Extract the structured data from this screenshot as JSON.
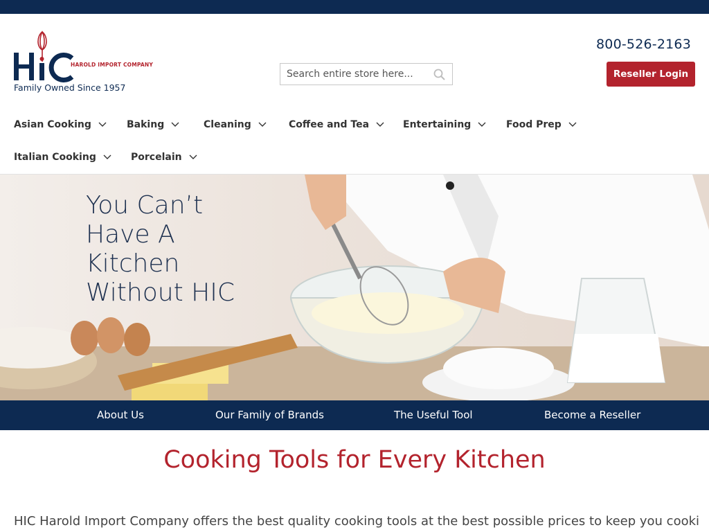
{
  "brand": {
    "logo_letters": "HIC",
    "company_name": "HAROLD IMPORT COMPANY",
    "tagline": "Family Owned Since 1957",
    "colors": {
      "navy": "#0d2a52",
      "red": "#b3232d"
    }
  },
  "header": {
    "search": {
      "placeholder": "Search entire store here...",
      "icon": "search-icon"
    },
    "phone": "800-526-2163",
    "reseller_login": "Reseller Login"
  },
  "categories": [
    {
      "label": "Asian Cooking"
    },
    {
      "label": "Baking"
    },
    {
      "label": "Cleaning"
    },
    {
      "label": "Coffee and Tea"
    },
    {
      "label": "Entertaining"
    },
    {
      "label": "Food Prep"
    },
    {
      "label": "Italian Cooking"
    },
    {
      "label": "Porcelain"
    }
  ],
  "hero": {
    "text": "You Can’t\nHave A\nKitchen\nWithout HIC"
  },
  "subnav": [
    {
      "label": "About Us"
    },
    {
      "label": "Our Family of Brands"
    },
    {
      "label": "The Useful Tool"
    },
    {
      "label": "Become a Reseller"
    }
  ],
  "main": {
    "headline": "Cooking Tools for Every Kitchen",
    "intro": "HIC Harold Import Company offers the best quality cooking tools at the best possible prices to keep you cooking all"
  }
}
